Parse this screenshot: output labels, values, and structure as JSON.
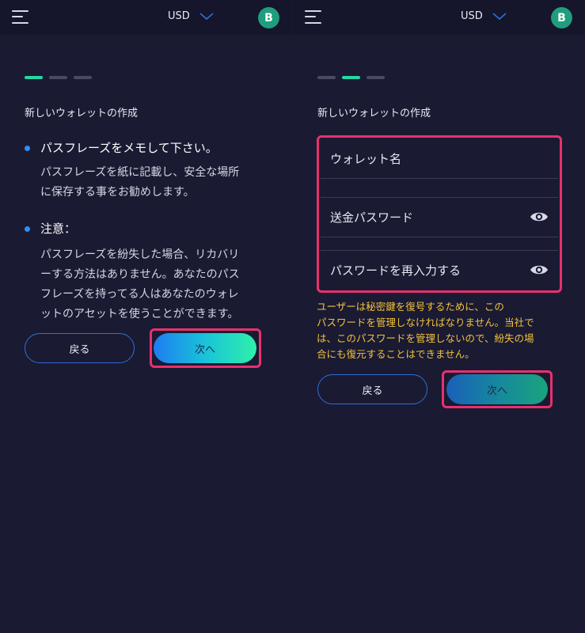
{
  "header": {
    "currency": "USD",
    "avatar_letter": "B"
  },
  "left_panel": {
    "title": "新しいウォレットの作成",
    "progress_active_step": 1,
    "progress_total_steps": 3,
    "bullets": [
      {
        "heading": "パスフレーズをメモして下さい。",
        "body_lines": [
          "パスフレーズを紙に記載し、安全な場所",
          "に保存する事をお勧めします。"
        ]
      },
      {
        "heading": "注意：",
        "body_lines": [
          "パスフレーズを紛失した場合、リカバリ",
          "ーする方法はありません。あなたのパス",
          "フレーズを持ってる人はあなたのウォレ",
          "ットのアセットを使うことができます。"
        ]
      }
    ],
    "back_label": "戻る",
    "next_label": "次へ"
  },
  "right_panel": {
    "title": "新しいウォレットの作成",
    "progress_active_step": 2,
    "progress_total_steps": 3,
    "fields": {
      "wallet_name": "ウォレット名",
      "send_password": "送金パスワード",
      "confirm_password": "パスワードを再入力する"
    },
    "warning_lines": [
      "ユーザーは秘密鍵を復号するために、この",
      "パスワードを管理しなければなりません。当社で",
      "は、このパスワードを管理しないので、紛失の場",
      "合にも復元することはできません。"
    ],
    "back_label": "戻る",
    "next_label": "次へ"
  },
  "colors": {
    "background": "#1a1a33",
    "accent_green": "#27d6a7",
    "accent_blue": "#2f8ff7",
    "highlight": "#e8316d",
    "warning": "#f2c23a"
  },
  "icons": {
    "menu": "hamburger-menu-icon",
    "currency_toggle": "chevron-down-icon",
    "password_visibility": "eye-icon"
  }
}
